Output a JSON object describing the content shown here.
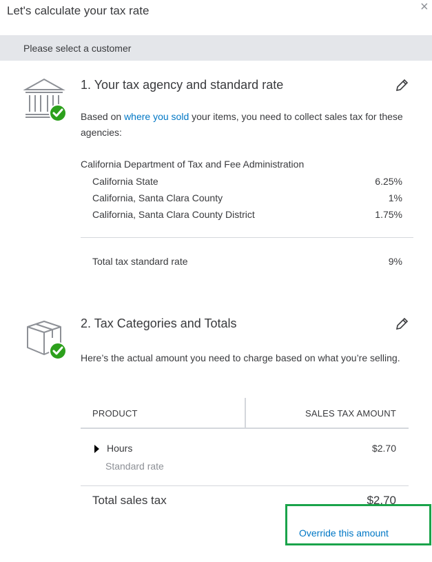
{
  "dialog": {
    "title": "Let's calculate your tax rate",
    "close_icon": "×"
  },
  "customer": {
    "prompt": "Please select a customer"
  },
  "section1": {
    "title": "1. Your tax agency and standard rate",
    "icon": "bank-building-icon",
    "desc_prefix": "Based on ",
    "desc_link": "where you sold",
    "desc_suffix": " your items, you need to collect sales tax for these agencies:",
    "agency": "California Department of Tax and Fee Administration",
    "rates": [
      {
        "name": "California State",
        "value": "6.25%"
      },
      {
        "name": "California, Santa Clara County",
        "value": "1%"
      },
      {
        "name": "California, Santa Clara County District",
        "value": "1.75%"
      }
    ],
    "total_label": "Total tax standard rate",
    "total_value": "9%"
  },
  "section2": {
    "title": "2. Tax Categories and Totals",
    "icon": "box-package-icon",
    "desc": "Here’s the actual amount you need to charge based on what you’re selling.",
    "columns": [
      "PRODUCT",
      "SALES TAX AMOUNT"
    ],
    "product": {
      "name": "Hours",
      "sub": "Standard rate",
      "amount": "$2.70"
    },
    "total_label": "Total sales tax",
    "total_value": "$2.70",
    "override_label": "Override this amount"
  },
  "colors": {
    "check_green": "#2ca01c",
    "link_blue": "#0077c5",
    "highlight_green": "#1aa34a",
    "customer_bar_gray": "#e4e6ea"
  }
}
